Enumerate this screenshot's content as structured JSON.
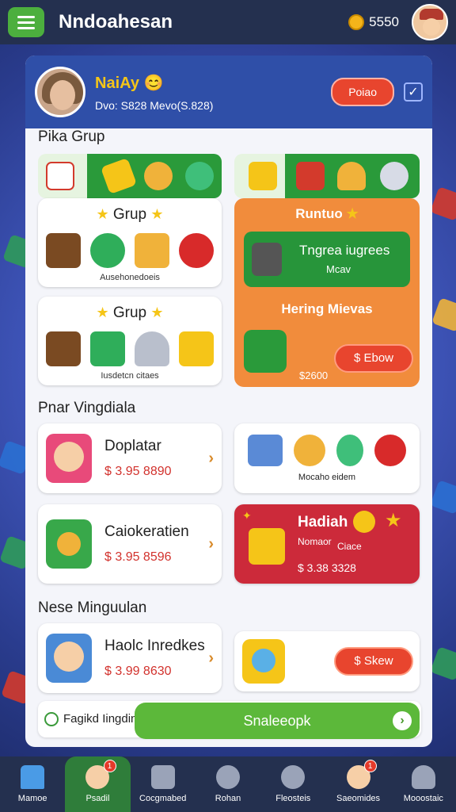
{
  "header": {
    "title": "Nndoahesan",
    "coins": "5550",
    "menu_icon": "hamburger-icon",
    "coin_icon": "coin-icon"
  },
  "profile": {
    "name": "NaiAy 😊",
    "stats": "Dvo: S828 Mevo(S.828)",
    "button": "Poiao",
    "check": "✓"
  },
  "section1": {
    "title": "Pika Grup"
  },
  "group_cards": [
    {
      "title": "Grup",
      "caption": "Ausehonedoeis"
    },
    {
      "title": "Grup",
      "caption": "Iusdetcn citaes"
    }
  ],
  "promo": {
    "title": "Runtuo",
    "inner_title": "Tngrea iugrees",
    "inner_sub": "Mcav",
    "subtitle": "Hering Mievas",
    "button": "$ Ebow",
    "price": "$2600"
  },
  "section2": {
    "title": "Pnar Vingdiala"
  },
  "offers_row1": [
    {
      "name": "Doplatar",
      "price": "$ 3.95 8890"
    },
    {
      "caption": "Mocaho eidem"
    }
  ],
  "offers_row2": [
    {
      "name": "Caiokeratien",
      "price": "$ 3.95 8596"
    },
    {
      "title": "Hadiah",
      "sub": "Nomaor",
      "sub2": "Ciace",
      "price": "$ 3.38 3328"
    }
  ],
  "section3": {
    "title": "Nese Minguulan"
  },
  "offers_row3": [
    {
      "name": "Haolc Inredkes",
      "price": "$ 3.99 8630"
    },
    {
      "button": "$ Skew"
    }
  ],
  "bottom_strip": {
    "label": "Fagikd Iingdinas",
    "cta": "Snaleeopk",
    "arrow": "›"
  },
  "nav": [
    {
      "label": "Mamoe",
      "icon": "home-icon",
      "badge": ""
    },
    {
      "label": "Psadil",
      "icon": "character-icon",
      "badge": "1"
    },
    {
      "label": "Cocgmabed",
      "icon": "save-icon",
      "badge": ""
    },
    {
      "label": "Rohan",
      "icon": "globe-icon",
      "badge": ""
    },
    {
      "label": "Fleosteis",
      "icon": "profile-icon",
      "badge": ""
    },
    {
      "label": "Saeomides",
      "icon": "friend-icon",
      "badge": "1"
    },
    {
      "label": "Mooostaic",
      "icon": "user-icon",
      "badge": ""
    }
  ]
}
